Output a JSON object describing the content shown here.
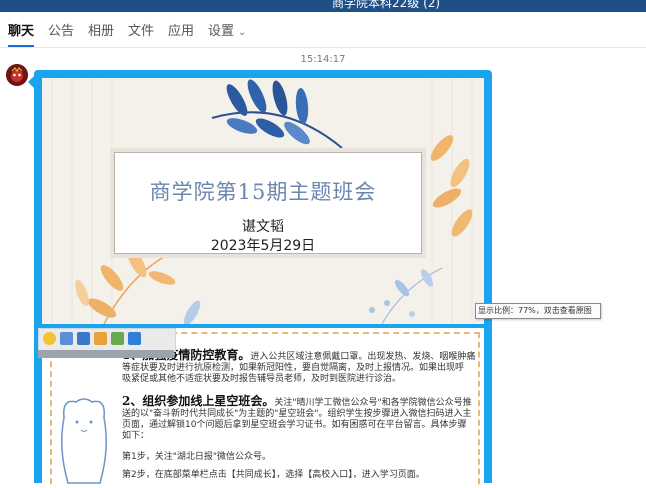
{
  "window": {
    "title": "商学院本科22级 (2)"
  },
  "tabs": [
    {
      "label": "聊天"
    },
    {
      "label": "公告"
    },
    {
      "label": "相册"
    },
    {
      "label": "文件"
    },
    {
      "label": "应用"
    },
    {
      "label": "设置"
    }
  ],
  "chat": {
    "timestamp": "15:14:17",
    "slide1": {
      "title": "商学院第15期主题班会",
      "author": "谌文韬",
      "date": "2023年5月29日"
    },
    "slide2": {
      "heading1": "1、加强疫情防控教育。",
      "body1a": "进入公共区域注意佩戴口罩。出现发热、发烧、咽喉肿痛",
      "body1b": "等症状要及时进行抗原检测，如果新冠阳性，要自觉隔离，及时上报情况。如果出现呼",
      "body1c": "吸紧促或其他不适症状要及时报告辅导员老师，及时到医院进行诊治。",
      "heading2": "2、组织参加线上星空班会。",
      "body2a": "关注\"晴川学工微信公众号\"和各学院微信公众号推",
      "body2b": "送的以\"奋斗新时代共同成长\"为主题的\"星空班会\"。组织学生按步骤进入微信扫码进入主",
      "body2c": "页面，通过解锁10个问题后拿到星空班会学习证书。如有困惑可在平台留言。具体步骤",
      "body2d": "如下：",
      "step1": "第1步，关注\"湖北日报\"微信公众号。",
      "step2": "第2步，在底部菜单栏点击【共同成长】，选择【高校入口】，进入学习页面。"
    },
    "tooltip": "显示比例：77%，双击查看原图"
  },
  "icons": {
    "settings_chevron": "chevron-down-icon",
    "toolbar": [
      "emoji-icon",
      "save-icon",
      "screen-icon",
      "gift-icon",
      "image-icon",
      "bookmark-icon"
    ]
  },
  "colors": {
    "bubble": "#1aa4ee",
    "active_tab": "#1a6fd4",
    "slide_title": "#6a86ae"
  }
}
